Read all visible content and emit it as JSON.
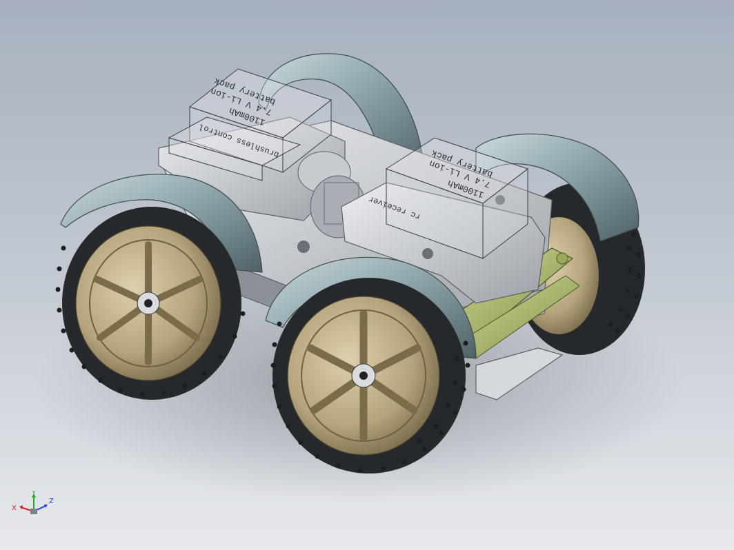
{
  "scene": {
    "labels": {
      "battery_rear": {
        "line1": "battery pack",
        "line2": "7.4 V Li-ion",
        "line3": "1100mAh"
      },
      "battery_front": {
        "line1": "battery pack",
        "line2": "7.4 V Li-ion",
        "line3": "1100mAh"
      },
      "esc": "brushless control",
      "receiver": "rc receiver"
    },
    "colors": {
      "background_top": "#a7b0bf",
      "background_bottom": "#e7e9ec",
      "fender": "#8fa7ac",
      "rim": "#b5a47c",
      "tire": "#25292c",
      "chassis": "#c9ccd0",
      "suspension": "#a8b96a"
    }
  },
  "triad": {
    "x_label": "X",
    "y_label": "Y",
    "z_label": "Z",
    "x_color": "#d02020",
    "y_color": "#20b020",
    "z_color": "#2040d0"
  }
}
